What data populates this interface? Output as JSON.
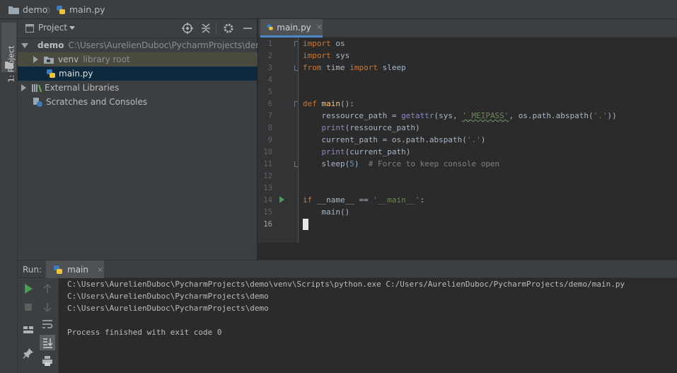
{
  "nav": {
    "project": "demo",
    "file": "main.py"
  },
  "left_stripe": {
    "label": "1: Project"
  },
  "project_panel": {
    "title": "Project",
    "tree": [
      {
        "name": "demo",
        "hint": "C:\\Users\\AurelienDuboc\\PycharmProjects\\demo"
      },
      {
        "name": "venv",
        "hint": "library root"
      },
      {
        "name": "main.py",
        "hint": ""
      },
      {
        "name": "External Libraries",
        "hint": ""
      },
      {
        "name": "Scratches and Consoles",
        "hint": ""
      }
    ]
  },
  "editor": {
    "tab_label": "main.py",
    "line_numbers": [
      "1",
      "2",
      "3",
      "4",
      "5",
      "6",
      "7",
      "8",
      "9",
      "10",
      "11",
      "12",
      "13",
      "14",
      "15",
      "16"
    ],
    "tokens": {
      "import": "import",
      "os": "os",
      "sys": "sys",
      "from": "from",
      "time": "time",
      "sleep": "sleep",
      "def": "def",
      "main": "main",
      "ressource_path": "ressource_path",
      "eq": " = ",
      "getattr": "getattr",
      "meipass": "'_MEIPASS'",
      "abspath_call": "os.path.abspath(",
      "dot_str": "'.'",
      "print": "print",
      "current_path": "current_path",
      "five": "5",
      "comment": "# Force to keep console open",
      "if": "if",
      "dunder_name": "__name__",
      "dunder_main_str": "'__main__'",
      "main_call": "main()"
    }
  },
  "run_panel": {
    "label": "Run:",
    "tab_label": "main",
    "console": [
      "C:\\Users\\AurelienDuboc\\PycharmProjects\\demo\\venv\\Scripts\\python.exe C:/Users/AurelienDuboc/PycharmProjects/demo/main.py",
      "C:\\Users\\AurelienDuboc\\PycharmProjects\\demo",
      "C:\\Users\\AurelienDuboc\\PycharmProjects\\demo",
      "Process finished with exit code 0"
    ]
  },
  "colors": {
    "accent": "#4a88c7",
    "selection": "#0d293e",
    "keyword": "#cc7832",
    "string": "#6a8759",
    "function": "#ffc66d",
    "builtin": "#8888c6",
    "run_green": "#499c54"
  }
}
